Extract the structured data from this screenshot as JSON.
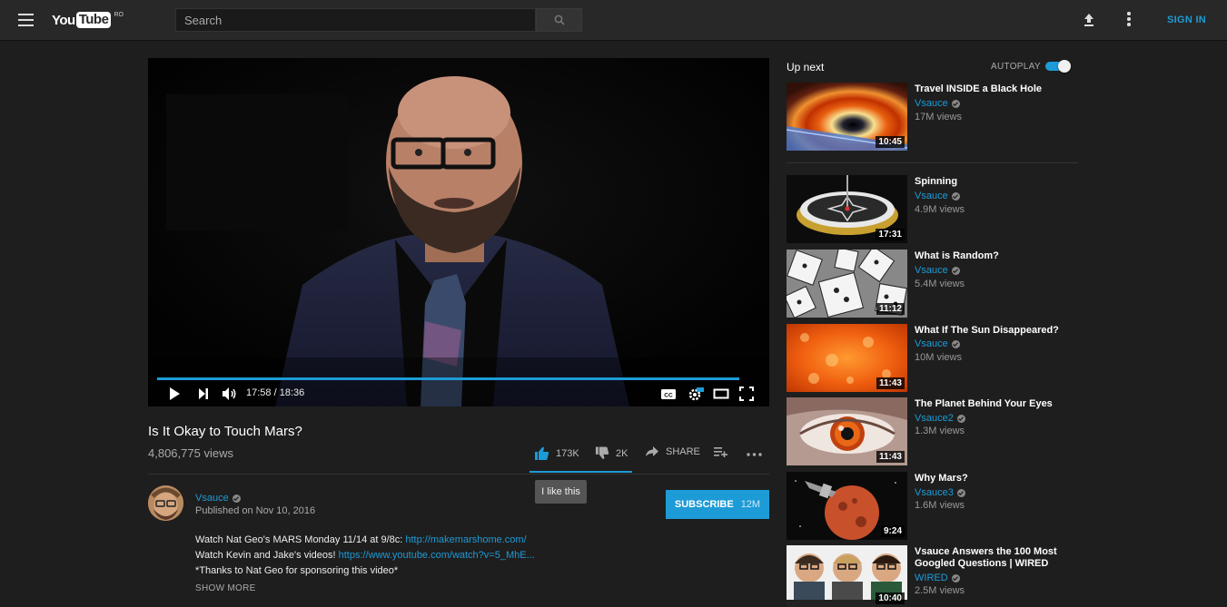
{
  "header": {
    "logo_you": "You",
    "logo_tube": "Tube",
    "logo_region": "RO",
    "search_placeholder": "Search",
    "sign_in": "SIGN IN"
  },
  "player": {
    "current_time": "17:58",
    "duration": "18:36",
    "progress_fraction": 0.966
  },
  "video": {
    "title": "Is It Okay to Touch Mars?",
    "views": "4,806,775 views",
    "likes": "173K",
    "dislikes": "2K",
    "share_label": "SHARE",
    "like_tooltip": "I like this"
  },
  "channel": {
    "name": "Vsauce",
    "published": "Published on Nov 10, 2016",
    "subscribe_label": "SUBSCRIBE",
    "subscriber_count": "12M"
  },
  "description": {
    "line1_text": "Watch Nat Geo's MARS Monday 11/14 at 9/8c: ",
    "line1_link": "http://makemarshome.com/",
    "line2_text": "Watch Kevin and Jake's videos! ",
    "line2_link": "https://www.youtube.com/watch?v=5_MhE...",
    "line3_text": "*Thanks to Nat Geo for sponsoring this video*",
    "show_more": "SHOW MORE"
  },
  "up_next": {
    "label": "Up next",
    "autoplay_label": "AUTOPLAY",
    "autoplay_on": true
  },
  "recommendations": [
    {
      "title": "Travel INSIDE a Black Hole",
      "channel": "Vsauce",
      "views": "17M views",
      "duration": "10:45"
    },
    {
      "title": "Spinning",
      "channel": "Vsauce",
      "views": "4.9M views",
      "duration": "17:31"
    },
    {
      "title": "What is Random?",
      "channel": "Vsauce",
      "views": "5.4M views",
      "duration": "11:12"
    },
    {
      "title": "What If The Sun Disappeared?",
      "channel": "Vsauce",
      "views": "10M views",
      "duration": "11:43"
    },
    {
      "title": "The Planet Behind Your Eyes",
      "channel": "Vsauce2",
      "views": "1.3M views",
      "duration": "11:43"
    },
    {
      "title": "Why Mars?",
      "channel": "Vsauce3",
      "views": "1.6M views",
      "duration": "9:24"
    },
    {
      "title": "Vsauce Answers the 100 Most Googled Questions | WIRED",
      "channel": "WIRED",
      "views": "2.5M views",
      "duration": "10:40"
    }
  ],
  "colors": {
    "accent": "#1d9bd7",
    "background": "#1e1e1e",
    "masthead": "#282828"
  }
}
